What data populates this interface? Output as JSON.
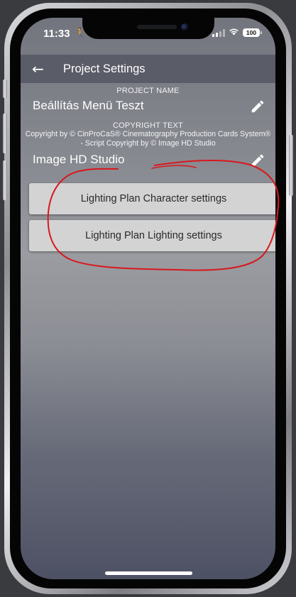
{
  "status_bar": {
    "time": "11:33",
    "person_glyph": "🚶",
    "wifi_glyph": "ᯤ",
    "battery": "100"
  },
  "app_bar": {
    "back_glyph": "←",
    "title": "Project Settings"
  },
  "project_name": {
    "label": "PROJECT NAME",
    "value": "Beállítás Menü Teszt"
  },
  "copyright": {
    "label": "COPYRIGHT TEXT",
    "text": "Copyright by © CinProCaS® Cinematography Production Cards System® - Script Copyright by © Image HD Studio",
    "value": "Image HD Studio"
  },
  "buttons": {
    "character_settings": "Lighting Plan Character settings",
    "lighting_settings": "Lighting Plan Lighting settings"
  },
  "colors": {
    "app_bar": "#5a5c68",
    "button_bg": "#d3d3d4",
    "annotation_red": "#d8181c"
  },
  "icons": [
    "back-arrow-icon",
    "edit-pencil-icon",
    "wifi-icon",
    "battery-icon",
    "signal-icon",
    "person-walking-icon"
  ]
}
